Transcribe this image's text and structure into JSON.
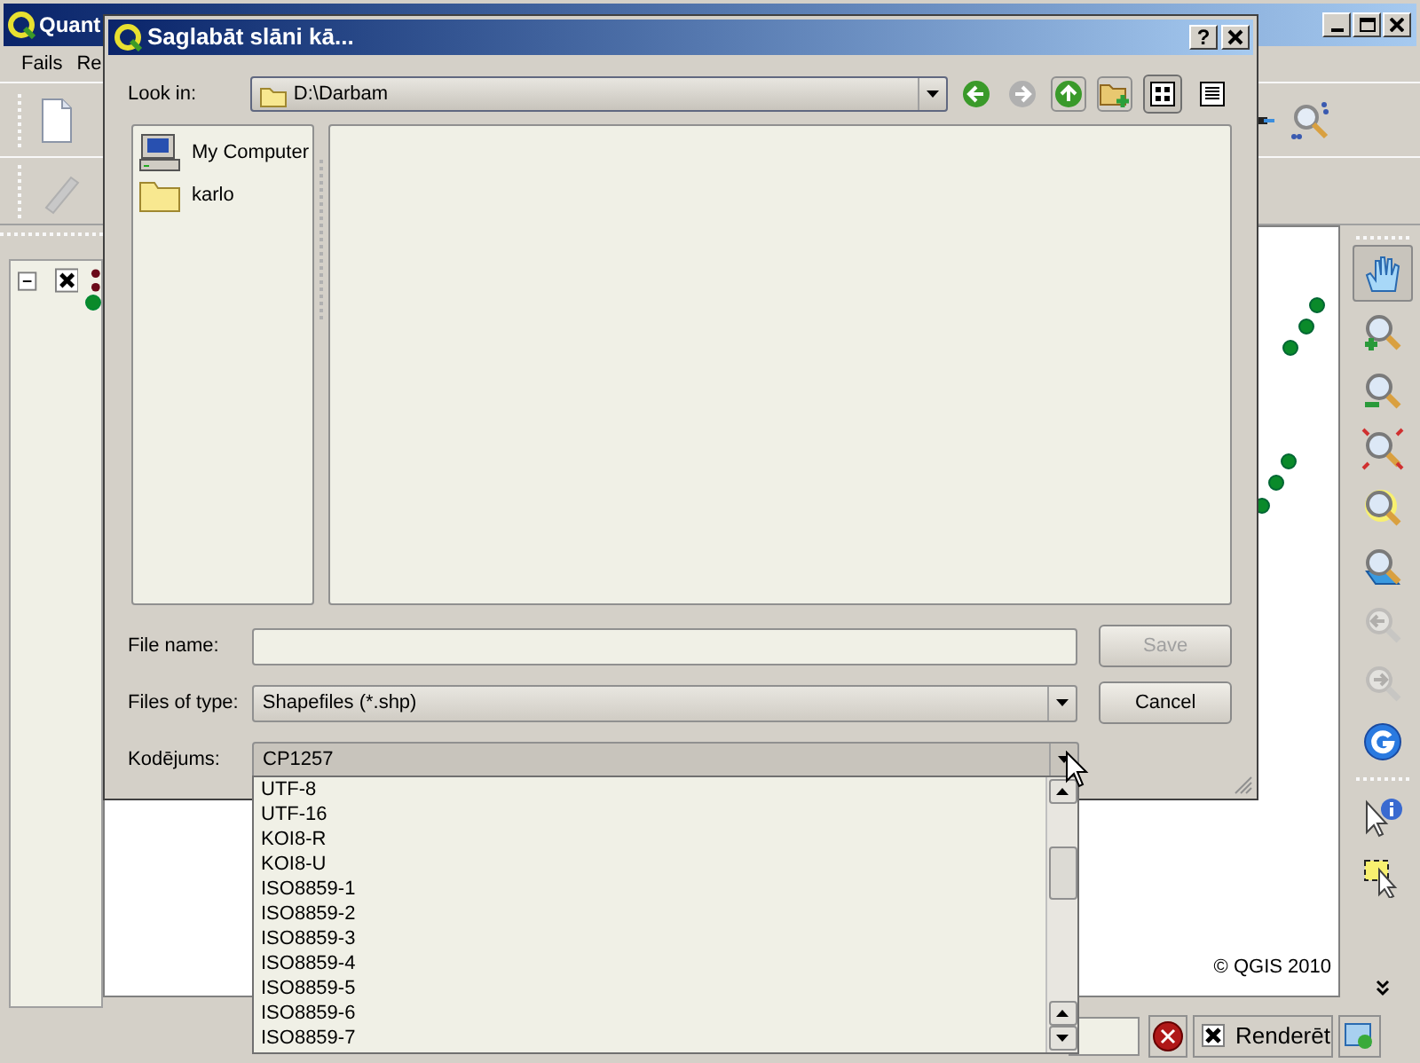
{
  "main_window": {
    "title": "Quant",
    "menu": [
      "Fails",
      "Re"
    ],
    "legend": {
      "layers": [
        {
          "checked": true,
          "expanded": true
        }
      ]
    },
    "map": {
      "copyright": "© QGIS 2010"
    },
    "map_tools": [
      {
        "kind": "pan",
        "selected": true,
        "disabled": false
      },
      {
        "kind": "zoom-in",
        "selected": false,
        "disabled": false
      },
      {
        "kind": "zoom-out",
        "selected": false,
        "disabled": false
      },
      {
        "kind": "zoom-full",
        "selected": false,
        "disabled": false
      },
      {
        "kind": "zoom-layer",
        "selected": false,
        "disabled": false
      },
      {
        "kind": "zoom-selection",
        "selected": false,
        "disabled": false
      },
      {
        "kind": "zoom-last",
        "selected": false,
        "disabled": true
      },
      {
        "kind": "zoom-next",
        "selected": false,
        "disabled": true
      },
      {
        "kind": "refresh",
        "selected": false,
        "disabled": false
      },
      {
        "kind": "identify",
        "selected": false,
        "disabled": false
      },
      {
        "kind": "select",
        "selected": false,
        "disabled": false
      }
    ],
    "status_bar": {
      "render": {
        "label": "Renderēt",
        "checked": true
      }
    }
  },
  "dialog": {
    "title": "Saglabāt slāni kā...",
    "help": "?",
    "look_in": {
      "label": "Look in:",
      "value": "D:\\Darbam"
    },
    "nav": [
      {
        "kind": "back",
        "disabled": false
      },
      {
        "kind": "forward",
        "disabled": true
      },
      {
        "kind": "up",
        "disabled": false
      },
      {
        "kind": "new-folder",
        "disabled": false
      }
    ],
    "view_buttons": [
      {
        "kind": "list",
        "selected": true
      },
      {
        "kind": "detail",
        "selected": false
      }
    ],
    "sidebar": [
      {
        "label": "My Computer",
        "kind": "computer"
      },
      {
        "label": "karlo",
        "kind": "folder"
      }
    ],
    "file_name": {
      "label": "File name:"
    },
    "files_of_type": {
      "label": "Files of type:",
      "value": "Shapefiles (*.shp)"
    },
    "encoding": {
      "label": "Kodējums:",
      "value": "CP1257",
      "expanded": true,
      "options": [
        "UTF-8",
        "UTF-16",
        "KOI8-R",
        "KOI8-U",
        "ISO8859-1",
        "ISO8859-2",
        "ISO8859-3",
        "ISO8859-4",
        "ISO8859-5",
        "ISO8859-6",
        "ISO8859-7"
      ]
    },
    "buttons": [
      {
        "label": "Save",
        "disabled": true
      },
      {
        "label": "Cancel",
        "disabled": false
      }
    ]
  }
}
